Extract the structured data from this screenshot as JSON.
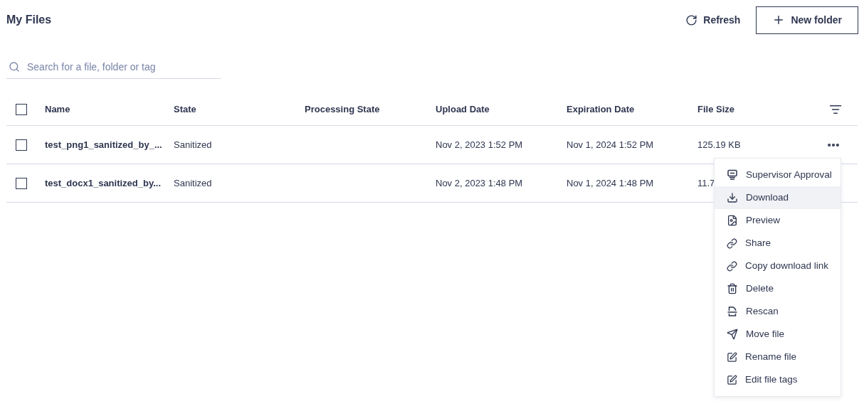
{
  "title": "My Files",
  "actions": {
    "refresh": "Refresh",
    "new_folder": "New folder"
  },
  "search": {
    "placeholder": "Search for a file, folder or tag"
  },
  "table": {
    "select_all_checked": false,
    "columns": [
      "Name",
      "State",
      "Processing State",
      "Upload Date",
      "Expiration Date",
      "File Size"
    ],
    "rows": [
      {
        "checked": false,
        "cells": [
          "test_png1_sanitized_by_...",
          "Sanitized",
          "",
          "Nov 2, 2023 1:52 PM",
          "Nov 1, 2024 1:52 PM",
          "125.19 KB"
        ],
        "menu_open": true
      },
      {
        "checked": false,
        "cells": [
          "test_docx1_sanitized_by...",
          "Sanitized",
          "",
          "Nov 2, 2023 1:48 PM",
          "Nov 1, 2024 1:48 PM",
          "11.7"
        ],
        "menu_open": false
      }
    ]
  },
  "context_menu": {
    "items": [
      {
        "label": "Supervisor Approval",
        "selected": false
      },
      {
        "label": "Download",
        "selected": true
      },
      {
        "label": "Preview",
        "selected": false
      },
      {
        "label": "Share",
        "selected": false
      },
      {
        "label": "Copy download link",
        "selected": false
      },
      {
        "label": "Delete",
        "selected": false
      },
      {
        "label": "Rescan",
        "selected": false
      },
      {
        "label": "Move file",
        "selected": false
      },
      {
        "label": "Rename file",
        "selected": false
      },
      {
        "label": "Edit file tags",
        "selected": false
      }
    ]
  }
}
